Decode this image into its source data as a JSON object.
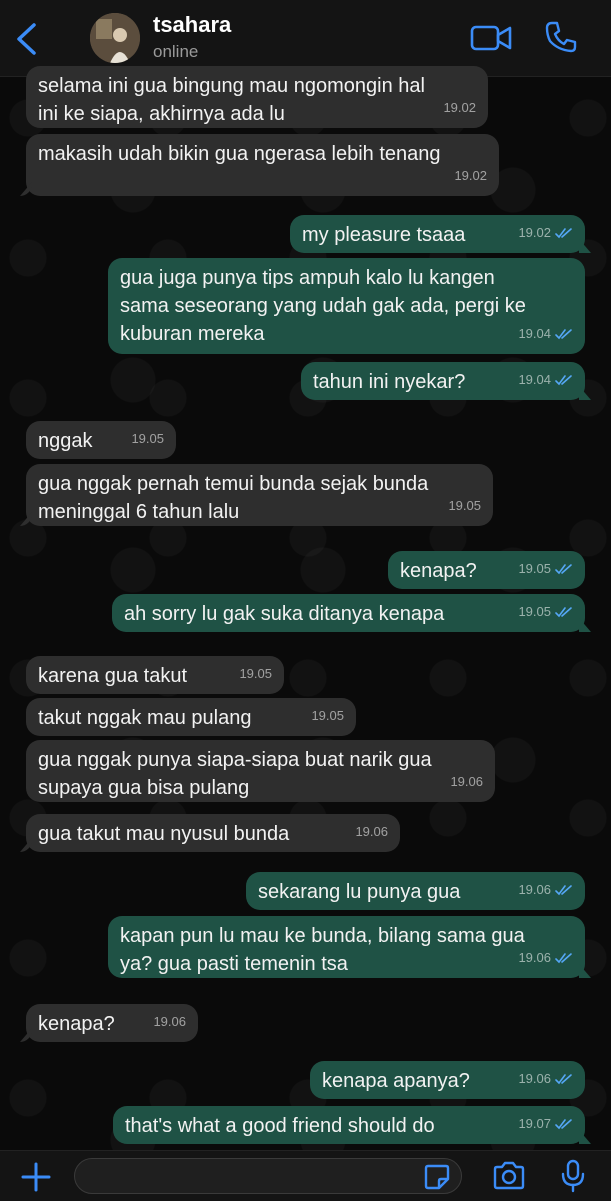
{
  "header": {
    "contact_name": "tsahara",
    "status": "online"
  },
  "colors": {
    "accent": "#3b8cf7",
    "incoming_bubble": "#2e2e2e",
    "outgoing_bubble": "#1f5245",
    "read_ticks": "#55a7f5"
  },
  "messages": [
    {
      "dir": "in",
      "text": "selama ini gua bingung mau ngomongin hal\nini ke siapa, akhirnya ada lu",
      "time": "19.02"
    },
    {
      "dir": "in",
      "text": "makasih udah bikin gua ngerasa lebih tenang",
      "time": "19.02"
    },
    {
      "dir": "out",
      "text": "my pleasure tsaaa",
      "time": "19.02",
      "read": true
    },
    {
      "dir": "out",
      "text": "gua juga punya tips ampuh kalo lu kangen\nsama seseorang yang udah gak ada, pergi ke\nkuburan mereka",
      "time": "19.04",
      "read": true
    },
    {
      "dir": "out",
      "text": "tahun ini nyekar?",
      "time": "19.04",
      "read": true
    },
    {
      "dir": "in",
      "text": "nggak",
      "time": "19.05"
    },
    {
      "dir": "in",
      "text": "gua nggak pernah temui bunda sejak bunda\nmeninggal 6 tahun lalu",
      "time": "19.05"
    },
    {
      "dir": "out",
      "text": "kenapa?",
      "time": "19.05",
      "read": true
    },
    {
      "dir": "out",
      "text": "ah sorry lu gak suka ditanya kenapa",
      "time": "19.05",
      "read": true
    },
    {
      "dir": "in",
      "text": "karena gua takut",
      "time": "19.05"
    },
    {
      "dir": "in",
      "text": "takut nggak mau pulang",
      "time": "19.05"
    },
    {
      "dir": "in",
      "text": "gua nggak punya siapa-siapa buat narik gua\nsupaya gua bisa pulang",
      "time": "19.06"
    },
    {
      "dir": "in",
      "text": "gua takut mau nyusul bunda",
      "time": "19.06"
    },
    {
      "dir": "out",
      "text": "sekarang lu punya gua",
      "time": "19.06",
      "read": true
    },
    {
      "dir": "out",
      "text": "kapan pun lu mau ke bunda, bilang sama gua\nya? gua pasti temenin tsa",
      "time": "19.06",
      "read": true
    },
    {
      "dir": "in",
      "text": "kenapa?",
      "time": "19.06"
    },
    {
      "dir": "out",
      "text": "kenapa apanya?",
      "time": "19.06",
      "read": true
    },
    {
      "dir": "out",
      "text": "that's what a good friend should do",
      "time": "19.07",
      "read": true
    }
  ],
  "composer": {
    "value": "",
    "placeholder": ""
  },
  "icons": {
    "back": "chevron-left-icon",
    "video": "video-camera-icon",
    "phone": "phone-icon",
    "plus": "plus-icon",
    "sticker": "sticker-icon",
    "camera": "camera-icon",
    "mic": "microphone-icon"
  }
}
